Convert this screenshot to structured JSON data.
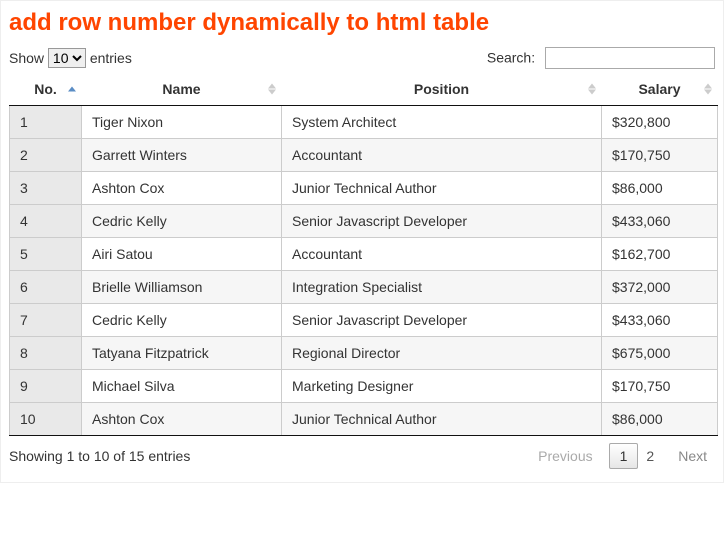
{
  "title": "add row number dynamically to html table",
  "length": {
    "show": "Show",
    "entries": "entries",
    "selected": "10"
  },
  "search": {
    "label": "Search:",
    "value": ""
  },
  "columns": {
    "no": "No.",
    "name": "Name",
    "position": "Position",
    "salary": "Salary"
  },
  "rows": [
    {
      "no": "1",
      "name": "Tiger Nixon",
      "position": "System Architect",
      "salary": "$320,800"
    },
    {
      "no": "2",
      "name": "Garrett Winters",
      "position": "Accountant",
      "salary": "$170,750"
    },
    {
      "no": "3",
      "name": "Ashton Cox",
      "position": "Junior Technical Author",
      "salary": "$86,000"
    },
    {
      "no": "4",
      "name": "Cedric Kelly",
      "position": "Senior Javascript Developer",
      "salary": "$433,060"
    },
    {
      "no": "5",
      "name": "Airi Satou",
      "position": "Accountant",
      "salary": "$162,700"
    },
    {
      "no": "6",
      "name": "Brielle Williamson",
      "position": "Integration Specialist",
      "salary": "$372,000"
    },
    {
      "no": "7",
      "name": "Cedric Kelly",
      "position": "Senior Javascript Developer",
      "salary": "$433,060"
    },
    {
      "no": "8",
      "name": "Tatyana Fitzpatrick",
      "position": "Regional Director",
      "salary": "$675,000"
    },
    {
      "no": "9",
      "name": "Michael Silva",
      "position": "Marketing Designer",
      "salary": "$170,750"
    },
    {
      "no": "10",
      "name": "Ashton Cox",
      "position": "Junior Technical Author",
      "salary": "$86,000"
    }
  ],
  "info": "Showing 1 to 10 of 15 entries",
  "paginate": {
    "previous": "Previous",
    "next": "Next",
    "pages": [
      "1",
      "2"
    ],
    "current": "1"
  }
}
